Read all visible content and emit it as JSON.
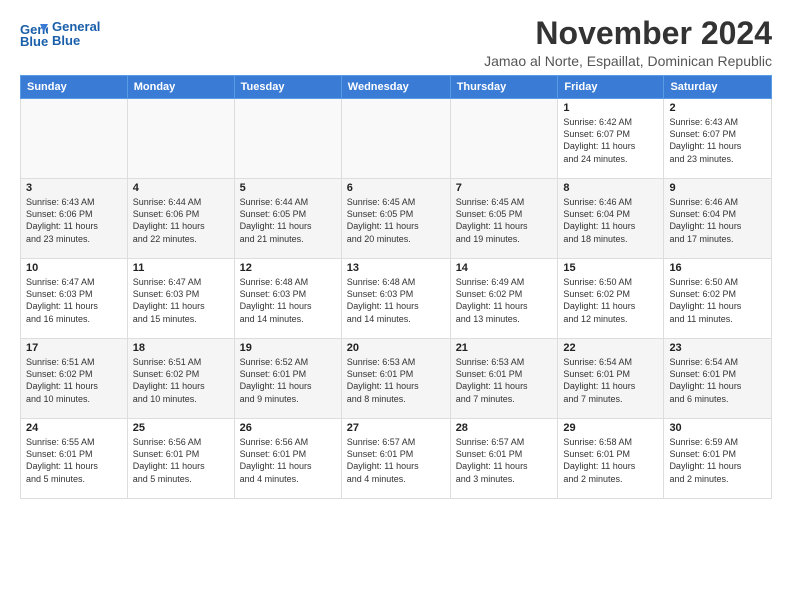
{
  "header": {
    "logo_line1": "General",
    "logo_line2": "Blue",
    "month_title": "November 2024",
    "location": "Jamao al Norte, Espaillat, Dominican Republic"
  },
  "days_of_week": [
    "Sunday",
    "Monday",
    "Tuesday",
    "Wednesday",
    "Thursday",
    "Friday",
    "Saturday"
  ],
  "weeks": [
    {
      "shaded": false,
      "days": [
        {
          "num": "",
          "info": ""
        },
        {
          "num": "",
          "info": ""
        },
        {
          "num": "",
          "info": ""
        },
        {
          "num": "",
          "info": ""
        },
        {
          "num": "",
          "info": ""
        },
        {
          "num": "1",
          "info": "Sunrise: 6:42 AM\nSunset: 6:07 PM\nDaylight: 11 hours\nand 24 minutes."
        },
        {
          "num": "2",
          "info": "Sunrise: 6:43 AM\nSunset: 6:07 PM\nDaylight: 11 hours\nand 23 minutes."
        }
      ]
    },
    {
      "shaded": true,
      "days": [
        {
          "num": "3",
          "info": "Sunrise: 6:43 AM\nSunset: 6:06 PM\nDaylight: 11 hours\nand 23 minutes."
        },
        {
          "num": "4",
          "info": "Sunrise: 6:44 AM\nSunset: 6:06 PM\nDaylight: 11 hours\nand 22 minutes."
        },
        {
          "num": "5",
          "info": "Sunrise: 6:44 AM\nSunset: 6:05 PM\nDaylight: 11 hours\nand 21 minutes."
        },
        {
          "num": "6",
          "info": "Sunrise: 6:45 AM\nSunset: 6:05 PM\nDaylight: 11 hours\nand 20 minutes."
        },
        {
          "num": "7",
          "info": "Sunrise: 6:45 AM\nSunset: 6:05 PM\nDaylight: 11 hours\nand 19 minutes."
        },
        {
          "num": "8",
          "info": "Sunrise: 6:46 AM\nSunset: 6:04 PM\nDaylight: 11 hours\nand 18 minutes."
        },
        {
          "num": "9",
          "info": "Sunrise: 6:46 AM\nSunset: 6:04 PM\nDaylight: 11 hours\nand 17 minutes."
        }
      ]
    },
    {
      "shaded": false,
      "days": [
        {
          "num": "10",
          "info": "Sunrise: 6:47 AM\nSunset: 6:03 PM\nDaylight: 11 hours\nand 16 minutes."
        },
        {
          "num": "11",
          "info": "Sunrise: 6:47 AM\nSunset: 6:03 PM\nDaylight: 11 hours\nand 15 minutes."
        },
        {
          "num": "12",
          "info": "Sunrise: 6:48 AM\nSunset: 6:03 PM\nDaylight: 11 hours\nand 14 minutes."
        },
        {
          "num": "13",
          "info": "Sunrise: 6:48 AM\nSunset: 6:03 PM\nDaylight: 11 hours\nand 14 minutes."
        },
        {
          "num": "14",
          "info": "Sunrise: 6:49 AM\nSunset: 6:02 PM\nDaylight: 11 hours\nand 13 minutes."
        },
        {
          "num": "15",
          "info": "Sunrise: 6:50 AM\nSunset: 6:02 PM\nDaylight: 11 hours\nand 12 minutes."
        },
        {
          "num": "16",
          "info": "Sunrise: 6:50 AM\nSunset: 6:02 PM\nDaylight: 11 hours\nand 11 minutes."
        }
      ]
    },
    {
      "shaded": true,
      "days": [
        {
          "num": "17",
          "info": "Sunrise: 6:51 AM\nSunset: 6:02 PM\nDaylight: 11 hours\nand 10 minutes."
        },
        {
          "num": "18",
          "info": "Sunrise: 6:51 AM\nSunset: 6:02 PM\nDaylight: 11 hours\nand 10 minutes."
        },
        {
          "num": "19",
          "info": "Sunrise: 6:52 AM\nSunset: 6:01 PM\nDaylight: 11 hours\nand 9 minutes."
        },
        {
          "num": "20",
          "info": "Sunrise: 6:53 AM\nSunset: 6:01 PM\nDaylight: 11 hours\nand 8 minutes."
        },
        {
          "num": "21",
          "info": "Sunrise: 6:53 AM\nSunset: 6:01 PM\nDaylight: 11 hours\nand 7 minutes."
        },
        {
          "num": "22",
          "info": "Sunrise: 6:54 AM\nSunset: 6:01 PM\nDaylight: 11 hours\nand 7 minutes."
        },
        {
          "num": "23",
          "info": "Sunrise: 6:54 AM\nSunset: 6:01 PM\nDaylight: 11 hours\nand 6 minutes."
        }
      ]
    },
    {
      "shaded": false,
      "days": [
        {
          "num": "24",
          "info": "Sunrise: 6:55 AM\nSunset: 6:01 PM\nDaylight: 11 hours\nand 5 minutes."
        },
        {
          "num": "25",
          "info": "Sunrise: 6:56 AM\nSunset: 6:01 PM\nDaylight: 11 hours\nand 5 minutes."
        },
        {
          "num": "26",
          "info": "Sunrise: 6:56 AM\nSunset: 6:01 PM\nDaylight: 11 hours\nand 4 minutes."
        },
        {
          "num": "27",
          "info": "Sunrise: 6:57 AM\nSunset: 6:01 PM\nDaylight: 11 hours\nand 4 minutes."
        },
        {
          "num": "28",
          "info": "Sunrise: 6:57 AM\nSunset: 6:01 PM\nDaylight: 11 hours\nand 3 minutes."
        },
        {
          "num": "29",
          "info": "Sunrise: 6:58 AM\nSunset: 6:01 PM\nDaylight: 11 hours\nand 2 minutes."
        },
        {
          "num": "30",
          "info": "Sunrise: 6:59 AM\nSunset: 6:01 PM\nDaylight: 11 hours\nand 2 minutes."
        }
      ]
    }
  ]
}
